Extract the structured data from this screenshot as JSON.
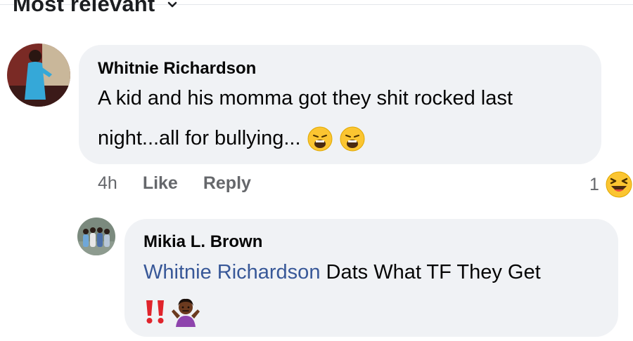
{
  "sort": {
    "label": "Most relevant",
    "chevron_icon": "chevron-down-icon"
  },
  "comment": {
    "author": "Whitnie Richardson",
    "line1": "A kid and his momma got they shit rocked last",
    "line2": "night...all for bullying...",
    "emojis": [
      "weary-face-icon",
      "weary-face-icon"
    ],
    "time": "4h",
    "like_label": "Like",
    "reply_label": "Reply",
    "reaction_count": "1",
    "reaction_icon": "laughing-face-icon"
  },
  "reply": {
    "author": "Mikia L. Brown",
    "mention": "Whitnie Richardson",
    "text": "Dats What TF They Get",
    "emojis": [
      "double-exclamation-icon",
      "person-shrugging-icon"
    ]
  },
  "colors": {
    "bubble": "#f0f2f5",
    "meta_text": "#65676b",
    "mention": "#385898"
  }
}
